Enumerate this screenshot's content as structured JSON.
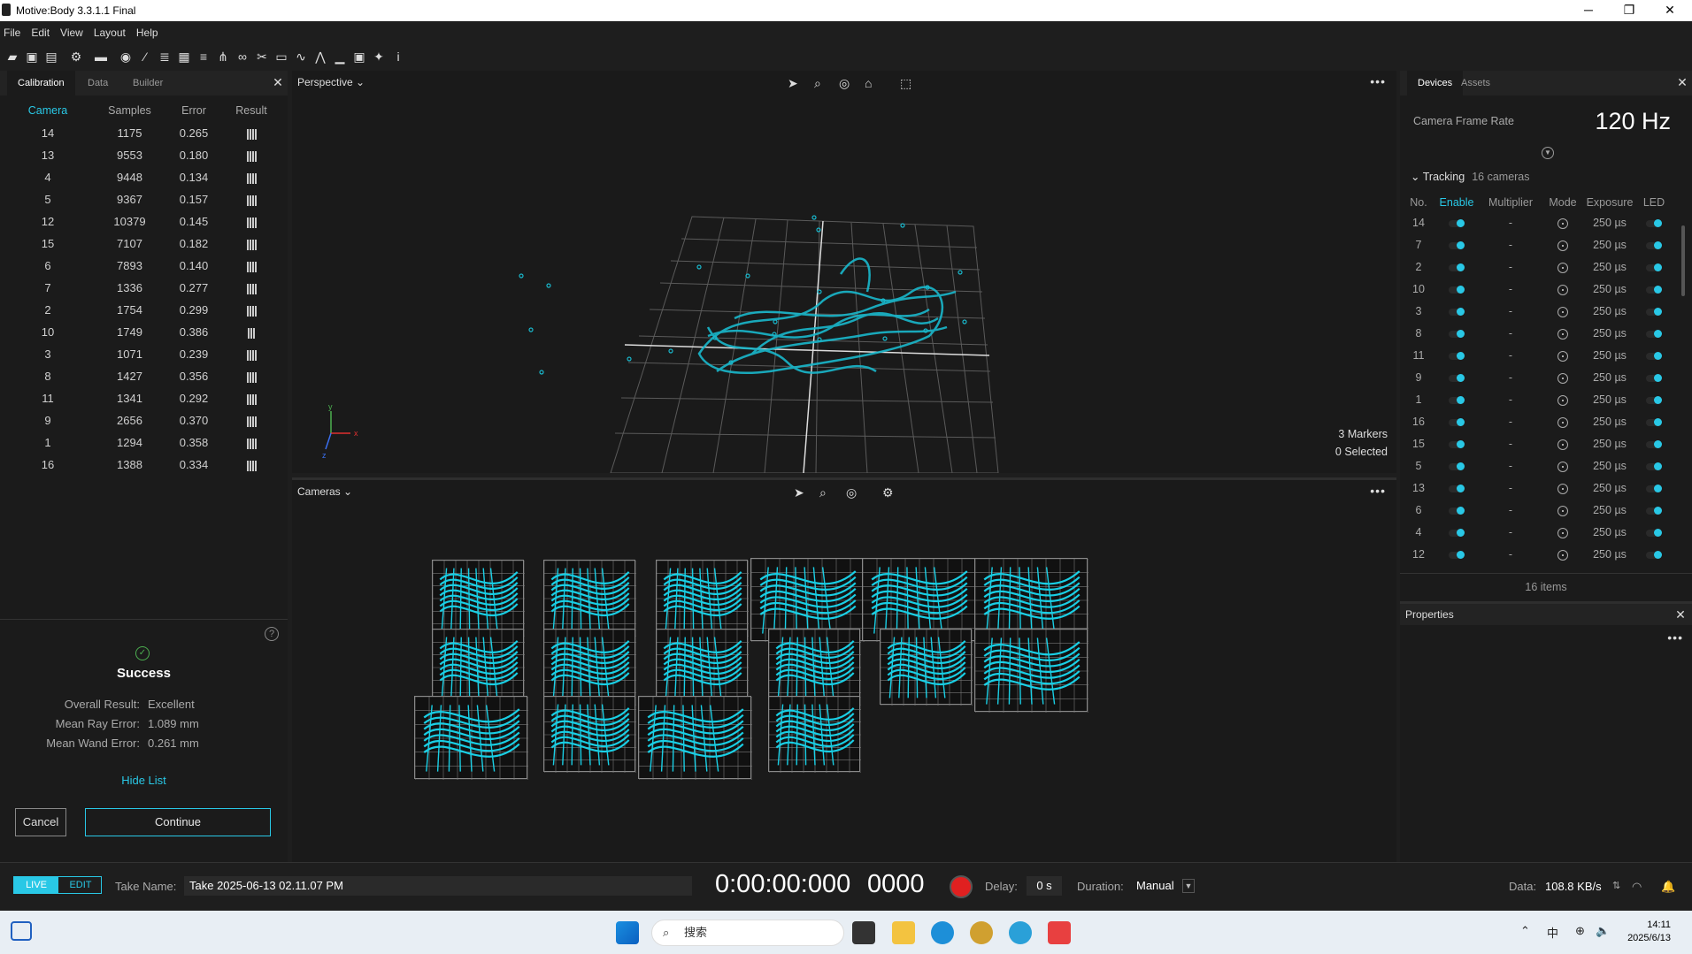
{
  "window": {
    "title": "Motive:Body 3.3.1.1 Final"
  },
  "menu": [
    "File",
    "Edit",
    "View",
    "Layout",
    "Help"
  ],
  "left_panel": {
    "tabs": [
      "Calibration",
      "Data",
      "Builder"
    ],
    "columns": [
      "Camera",
      "Samples",
      "Error",
      "Result"
    ],
    "rows": [
      {
        "camera": "14",
        "samples": "1175",
        "error": "0.265",
        "bars": 4
      },
      {
        "camera": "13",
        "samples": "9553",
        "error": "0.180",
        "bars": 4
      },
      {
        "camera": "4",
        "samples": "9448",
        "error": "0.134",
        "bars": 4
      },
      {
        "camera": "5",
        "samples": "9367",
        "error": "0.157",
        "bars": 4
      },
      {
        "camera": "12",
        "samples": "10379",
        "error": "0.145",
        "bars": 4
      },
      {
        "camera": "15",
        "samples": "7107",
        "error": "0.182",
        "bars": 4
      },
      {
        "camera": "6",
        "samples": "7893",
        "error": "0.140",
        "bars": 4
      },
      {
        "camera": "7",
        "samples": "1336",
        "error": "0.277",
        "bars": 4
      },
      {
        "camera": "2",
        "samples": "1754",
        "error": "0.299",
        "bars": 4
      },
      {
        "camera": "10",
        "samples": "1749",
        "error": "0.386",
        "bars": 3
      },
      {
        "camera": "3",
        "samples": "1071",
        "error": "0.239",
        "bars": 4
      },
      {
        "camera": "8",
        "samples": "1427",
        "error": "0.356",
        "bars": 4
      },
      {
        "camera": "11",
        "samples": "1341",
        "error": "0.292",
        "bars": 4
      },
      {
        "camera": "9",
        "samples": "2656",
        "error": "0.370",
        "bars": 4
      },
      {
        "camera": "1",
        "samples": "1294",
        "error": "0.358",
        "bars": 4
      },
      {
        "camera": "16",
        "samples": "1388",
        "error": "0.334",
        "bars": 4
      }
    ],
    "summary": {
      "status": "Success",
      "overall_label": "Overall Result:",
      "overall_value": "Excellent",
      "ray_label": "Mean Ray Error:",
      "ray_value": "1.089 mm",
      "wand_label": "Mean Wand Error:",
      "wand_value": "0.261 mm",
      "hide_list": "Hide List",
      "cancel": "Cancel",
      "continue": "Continue"
    }
  },
  "viewport": {
    "view_label": "Perspective",
    "markers": "3 Markers",
    "selected": "0 Selected",
    "axis_x": "x",
    "axis_y": "y",
    "axis_z": "z"
  },
  "cameras_view": {
    "label": "Cameras"
  },
  "right_panel": {
    "tabs": [
      "Devices",
      "Assets"
    ],
    "frame_rate_label": "Camera Frame Rate",
    "frame_rate_value": "120 Hz",
    "tracking_label": "Tracking",
    "tracking_count": "16 cameras",
    "columns": [
      "No.",
      "Enable",
      "Multiplier",
      "Mode",
      "Exposure",
      "LED"
    ],
    "devices": [
      {
        "no": "14",
        "multiplier": "-",
        "exposure": "250 µs"
      },
      {
        "no": "7",
        "multiplier": "-",
        "exposure": "250 µs"
      },
      {
        "no": "2",
        "multiplier": "-",
        "exposure": "250 µs"
      },
      {
        "no": "10",
        "multiplier": "-",
        "exposure": "250 µs"
      },
      {
        "no": "3",
        "multiplier": "-",
        "exposure": "250 µs"
      },
      {
        "no": "8",
        "multiplier": "-",
        "exposure": "250 µs"
      },
      {
        "no": "11",
        "multiplier": "-",
        "exposure": "250 µs"
      },
      {
        "no": "9",
        "multiplier": "-",
        "exposure": "250 µs"
      },
      {
        "no": "1",
        "multiplier": "-",
        "exposure": "250 µs"
      },
      {
        "no": "16",
        "multiplier": "-",
        "exposure": "250 µs"
      },
      {
        "no": "15",
        "multiplier": "-",
        "exposure": "250 µs"
      },
      {
        "no": "5",
        "multiplier": "-",
        "exposure": "250 µs"
      },
      {
        "no": "13",
        "multiplier": "-",
        "exposure": "250 µs"
      },
      {
        "no": "6",
        "multiplier": "-",
        "exposure": "250 µs"
      },
      {
        "no": "4",
        "multiplier": "-",
        "exposure": "250 µs"
      },
      {
        "no": "12",
        "multiplier": "-",
        "exposure": "250 µs"
      }
    ],
    "items_count": "16 items",
    "properties_title": "Properties"
  },
  "bottom": {
    "live": "LIVE",
    "edit": "EDIT",
    "take_label": "Take Name:",
    "take_name": "Take 2025-06-13 02.11.07 PM",
    "timecode": "0:00:00:000",
    "frame": "0000",
    "delay_label": "Delay:",
    "delay_value": "0 s",
    "duration_label": "Duration:",
    "duration_value": "Manual",
    "data_label": "Data:",
    "data_value": "108.8 KB/s"
  },
  "taskbar": {
    "search_placeholder": "搜索",
    "ime": "中",
    "time": "14:11",
    "date": "2025/6/13"
  },
  "colors": {
    "accent": "#29c8e6",
    "record": "#e02020",
    "success": "#4caf50"
  }
}
